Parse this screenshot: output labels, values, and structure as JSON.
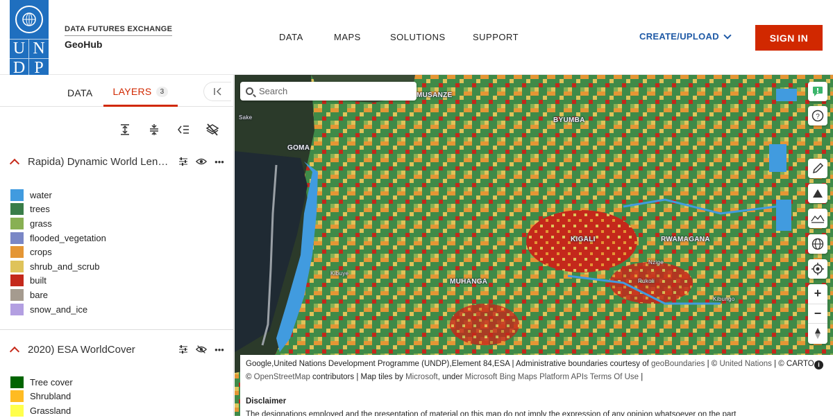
{
  "header": {
    "logo": {
      "letters": [
        "U",
        "N",
        "D",
        "P"
      ],
      "icon": "un-emblem-icon"
    },
    "brand_sub": "DATA FUTURES EXCHANGE",
    "brand_name": "GeoHub",
    "nav": [
      "DATA",
      "MAPS",
      "SOLUTIONS",
      "SUPPORT"
    ],
    "create_upload": "CREATE/UPLOAD",
    "sign_in": "SIGN IN"
  },
  "sidebar": {
    "tabs": {
      "data": "DATA",
      "layers": "LAYERS",
      "layers_count": "3"
    },
    "layers": [
      {
        "title": "Rapida) Dynamic World Lend ...",
        "visible": true,
        "legend": [
          {
            "label": "water",
            "color": "#419bdf"
          },
          {
            "label": "trees",
            "color": "#397d49"
          },
          {
            "label": "grass",
            "color": "#88b053"
          },
          {
            "label": "flooded_vegetation",
            "color": "#7a87c6"
          },
          {
            "label": "crops",
            "color": "#e49635"
          },
          {
            "label": "shrub_and_scrub",
            "color": "#dfc35a"
          },
          {
            "label": "built",
            "color": "#c4281b"
          },
          {
            "label": "bare",
            "color": "#a59b8f"
          },
          {
            "label": "snow_and_ice",
            "color": "#b39fe1"
          }
        ]
      },
      {
        "title": "2020) ESA WorldCover",
        "visible": false,
        "legend": [
          {
            "label": "Tree cover",
            "color": "#006400"
          },
          {
            "label": "Shrubland",
            "color": "#ffbb22"
          },
          {
            "label": "Grassland",
            "color": "#ffff4c"
          }
        ]
      }
    ]
  },
  "map": {
    "search_placeholder": "Search",
    "places": {
      "musanze": "MUSANZE",
      "byumba": "BYUMBA",
      "goma": "GOMA",
      "sake": "Sake",
      "kigali": "KIGALI",
      "rwamagana": "RWAMAGANA",
      "kibuye": "Kibuye",
      "muhanga": "MUHANGA",
      "nzige": "Nzige",
      "rukoli": "Rukoli",
      "kibungo": "Kibungo"
    },
    "attribution": {
      "part1": "Google,United Nations Development Programme (UNDP),Element 84,ESA | Administrative boundaries courtesy of ",
      "link_geoboundaries": "geoBoundaries",
      "sep1": " | © ",
      "link_un": "United Nations",
      "sep2": " | © CARTO,",
      "line2_prefix": "© ",
      "link_osm": "OpenStreetMap",
      "line2_mid": " contributors | Map tiles by ",
      "link_ms": "Microsoft",
      "line2_mid2": ", under ",
      "link_bing": "Microsoft Bing Maps Platform APIs Terms Of Use",
      "line2_end": " |",
      "info": "i"
    },
    "disclaimer_title": "Disclaimer",
    "disclaimer_text": "The designations employed and the presentation of material on this map do not imply the expression of any opinion whatsoever on the part"
  }
}
